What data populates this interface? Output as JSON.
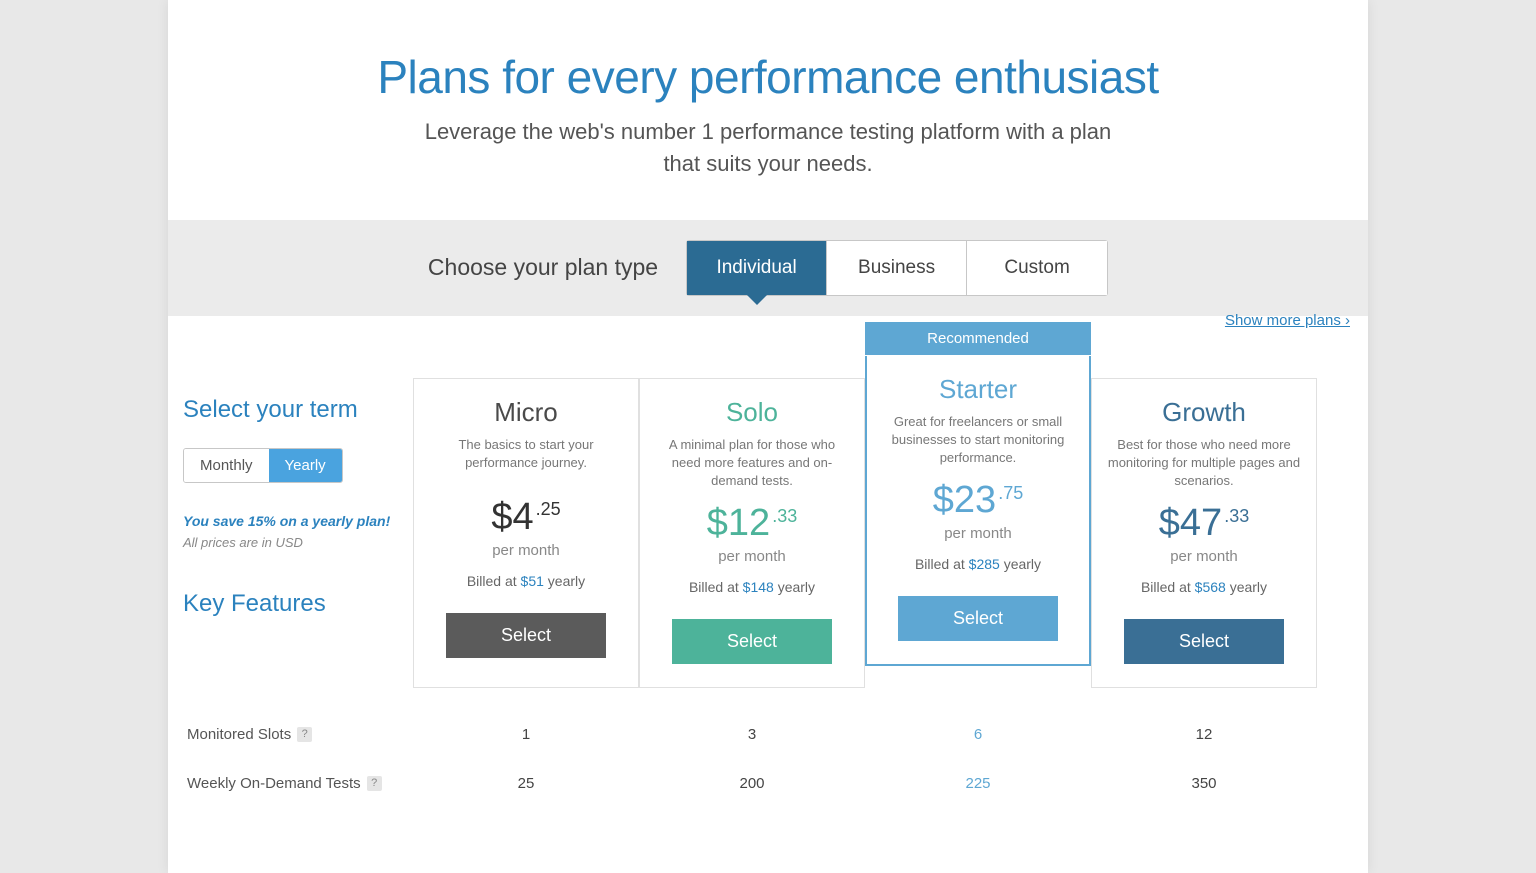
{
  "header": {
    "title": "Plans for every performance enthusiast",
    "subtitle": "Leverage the web's number 1 performance testing platform with a plan that suits your needs."
  },
  "planTypeSelector": {
    "label": "Choose your plan type",
    "tabs": [
      "Individual",
      "Business",
      "Custom"
    ],
    "activeTab": "Individual"
  },
  "sidebar": {
    "termTitle": "Select your term",
    "termOptions": [
      "Monthly",
      "Yearly"
    ],
    "termActive": "Yearly",
    "savingsText": "You save 15% on a yearly plan!",
    "currencyNote": "All prices are in USD",
    "keyFeaturesTitle": "Key Features"
  },
  "showMorePlans": "Show more plans ›",
  "recommendedLabel": "Recommended",
  "plans": [
    {
      "name": "Micro",
      "description": "The basics to start your performance journey.",
      "priceWhole": "$4",
      "priceCents": ".25",
      "perMonth": "per month",
      "billedPrefix": "Billed at ",
      "billedAmount": "$51",
      "billedSuffix": " yearly",
      "selectLabel": "Select",
      "recommended": false
    },
    {
      "name": "Solo",
      "description": "A minimal plan for those who need more features and on-demand tests.",
      "priceWhole": "$12",
      "priceCents": ".33",
      "perMonth": "per month",
      "billedPrefix": "Billed at ",
      "billedAmount": "$148",
      "billedSuffix": " yearly",
      "selectLabel": "Select",
      "recommended": false
    },
    {
      "name": "Starter",
      "description": "Great for freelancers or small businesses to start monitoring performance.",
      "priceWhole": "$23",
      "priceCents": ".75",
      "perMonth": "per month",
      "billedPrefix": "Billed at ",
      "billedAmount": "$285",
      "billedSuffix": " yearly",
      "selectLabel": "Select",
      "recommended": true
    },
    {
      "name": "Growth",
      "description": "Best for those who need more monitoring for multiple pages and scenarios.",
      "priceWhole": "$47",
      "priceCents": ".33",
      "perMonth": "per month",
      "billedPrefix": "Billed at ",
      "billedAmount": "$568",
      "billedSuffix": " yearly",
      "selectLabel": "Select",
      "recommended": false
    }
  ],
  "features": [
    {
      "label": "Monitored Slots",
      "values": [
        "1",
        "3",
        "6",
        "12"
      ]
    },
    {
      "label": "Weekly On-Demand Tests",
      "values": [
        "25",
        "200",
        "225",
        "350"
      ]
    }
  ]
}
